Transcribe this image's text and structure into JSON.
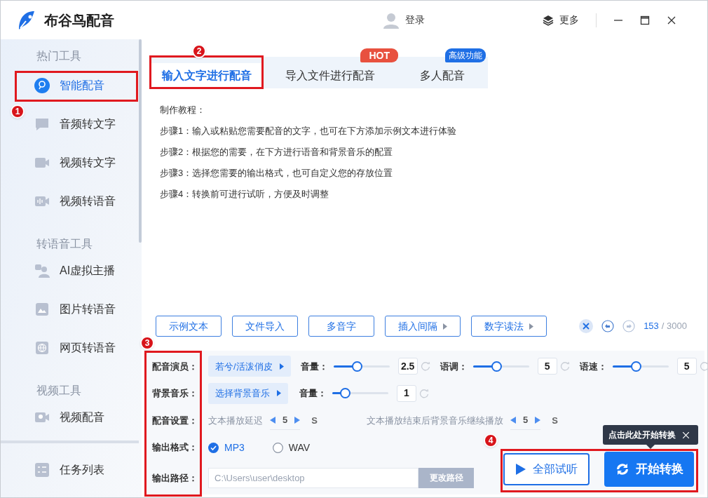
{
  "window": {
    "title": "布谷鸟配音",
    "login": "登录",
    "more": "更多"
  },
  "sidebar": {
    "sections": [
      {
        "heading": "热门工具",
        "items": [
          {
            "label": "智能配音",
            "selected": true
          },
          {
            "label": "音频转文字",
            "selected": false
          },
          {
            "label": "视频转文字",
            "selected": false
          },
          {
            "label": "视频转语音",
            "selected": false
          }
        ]
      },
      {
        "heading": "转语音工具",
        "items": [
          {
            "label": "AI虚拟主播",
            "selected": false
          },
          {
            "label": "图片转语音",
            "selected": false
          },
          {
            "label": "网页转语音",
            "selected": false
          }
        ]
      },
      {
        "heading": "视频工具",
        "items": [
          {
            "label": "视频配音",
            "selected": false
          }
        ]
      }
    ],
    "footer_item": {
      "label": "任务列表"
    }
  },
  "tabs": [
    {
      "label": "输入文字进行配音",
      "selected": true
    },
    {
      "label": "导入文件进行配音",
      "selected": false,
      "badge": {
        "text": "HOT",
        "kind": "hot"
      }
    },
    {
      "label": "多人配音",
      "selected": false,
      "badge": {
        "text": "高级功能",
        "kind": "pro"
      }
    }
  ],
  "tutorial": [
    "制作教程：",
    "步骤1：输入或粘贴您需要配音的文字，也可在下方添加示例文本进行体验",
    "步骤2：根据您的需要，在下方进行语音和背景音乐的配置",
    "步骤3：选择您需要的输出格式，也可自定义您的存放位置",
    "步骤4：转换前可进行试听，方便及时调整"
  ],
  "toolbar": [
    {
      "label": "示例文本",
      "has_menu": false
    },
    {
      "label": "文件导入",
      "has_menu": false
    },
    {
      "label": "多音字",
      "has_menu": false
    },
    {
      "label": "插入间隔",
      "has_menu": true
    },
    {
      "label": "数字读法",
      "has_menu": true
    }
  ],
  "counter": {
    "count": "153",
    "limit": "/ 3000"
  },
  "voice": {
    "label": "配音演员：",
    "chip": "若兮/活泼俏皮",
    "sliders": [
      {
        "label": "音量：",
        "level": 0.42,
        "value": "2.5"
      },
      {
        "label": "语调：",
        "level": 0.42,
        "value": "5"
      },
      {
        "label": "语速：",
        "level": 0.42,
        "value": "5"
      }
    ]
  },
  "music": {
    "label": "背景音乐：",
    "chip": "选择背景音乐",
    "sliders": [
      {
        "label": "音量：",
        "level": 0.22,
        "value": "1"
      }
    ]
  },
  "dubbing": {
    "label": "配音设置：",
    "steppers": [
      {
        "label": "文本播放延迟",
        "value": "5",
        "unit": "S"
      },
      {
        "label": "文本播放结束后背景音乐继续播放",
        "value": "5",
        "unit": "S"
      }
    ]
  },
  "format": {
    "label": "输出格式：",
    "options": [
      {
        "label": "MP3",
        "selected": true
      },
      {
        "label": "WAV",
        "selected": false
      }
    ]
  },
  "path": {
    "label": "输出路径：",
    "value": "C:\\Users\\user\\desktop",
    "button": "更改路径"
  },
  "actions": [
    {
      "label": "全部试听",
      "kind": "outline"
    },
    {
      "label": "开始转换",
      "kind": "primary"
    }
  ],
  "tooltip": {
    "text": "点击此处开始转换"
  },
  "annotations": [
    {
      "number": "1"
    },
    {
      "number": "2"
    },
    {
      "number": "3"
    },
    {
      "number": "4"
    }
  ]
}
